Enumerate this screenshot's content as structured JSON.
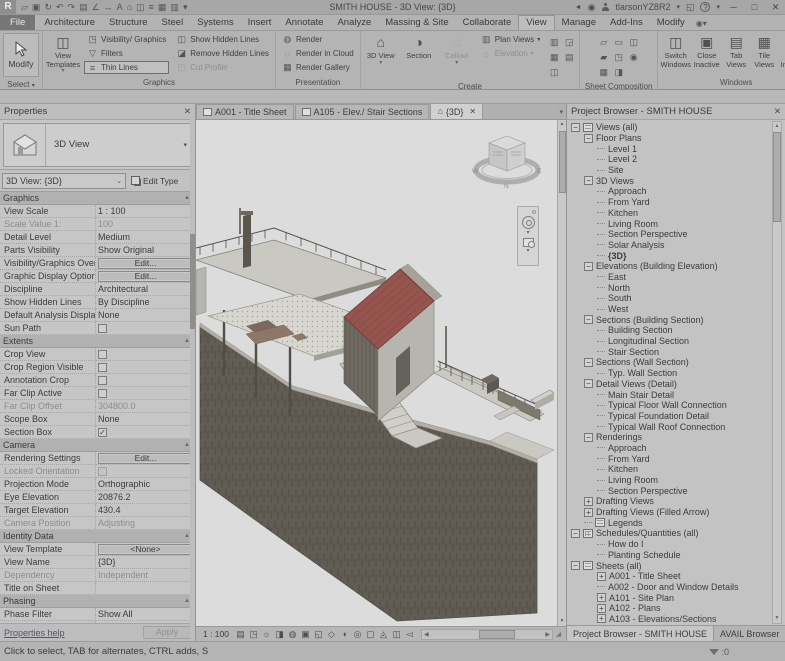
{
  "titlebar": {
    "app_initial": "R",
    "title": "SMITH HOUSE - 3D View: {3D}",
    "user": "tlarsonYZ8R2",
    "help": "?",
    "qat": [
      {
        "name": "open-file-icon",
        "glyph": "▱"
      },
      {
        "name": "save-icon",
        "glyph": "▣"
      },
      {
        "name": "synchronize-icon",
        "glyph": "↻"
      },
      {
        "name": "undo-icon",
        "glyph": "↶"
      },
      {
        "name": "redo-icon",
        "glyph": "↷"
      },
      {
        "name": "print-icon",
        "glyph": "▤"
      },
      {
        "name": "measure-icon",
        "glyph": "∠"
      },
      {
        "name": "aligned-dimension-icon",
        "glyph": "↔"
      },
      {
        "name": "text-note-icon",
        "glyph": "A"
      },
      {
        "name": "default-3d-view-icon",
        "glyph": "⌂"
      },
      {
        "name": "section-icon",
        "glyph": "◫"
      },
      {
        "name": "thin-lines-icon",
        "glyph": "≡"
      },
      {
        "name": "close-hidden-windows-icon",
        "glyph": "▦"
      },
      {
        "name": "switch-windows-icon",
        "glyph": "▥"
      },
      {
        "name": "customize-qat-icon",
        "glyph": "▾"
      }
    ]
  },
  "menu": {
    "tabs": [
      {
        "label": "File",
        "file": true
      },
      {
        "label": "Architecture"
      },
      {
        "label": "Structure"
      },
      {
        "label": "Steel"
      },
      {
        "label": "Systems"
      },
      {
        "label": "Insert"
      },
      {
        "label": "Annotate"
      },
      {
        "label": "Analyze"
      },
      {
        "label": "Massing & Site"
      },
      {
        "label": "Collaborate"
      },
      {
        "label": "View",
        "active": true
      },
      {
        "label": "Manage"
      },
      {
        "label": "Add-Ins"
      },
      {
        "label": "Modify"
      }
    ]
  },
  "ribbon": {
    "select": {
      "button": "Modify",
      "panel": "Select"
    },
    "graphics": {
      "big": "View Templates",
      "col1": [
        "Visibility/ Graphics",
        "Filters",
        "Thin Lines"
      ],
      "col2": [
        "Show Hidden Lines",
        "Remove Hidden Lines",
        "Cut Profile"
      ],
      "panel": "Graphics"
    },
    "presentation": {
      "items": [
        "Render",
        "Render in Cloud",
        "Render Gallery"
      ],
      "panel": "Presentation"
    },
    "create": {
      "bigs": [
        "3D View",
        "Section",
        "Callout"
      ],
      "col": [
        "Plan Views",
        "Elevation"
      ],
      "extra": [
        {
          "glyph": "▥"
        },
        {
          "glyph": "◲"
        },
        {
          "glyph": "▦"
        },
        {
          "glyph": "▤"
        },
        {
          "glyph": "◫"
        }
      ],
      "panel": "Create"
    },
    "sheet": {
      "icons": [
        "▱",
        "▭",
        "◫",
        "▰",
        "◳",
        "◉",
        "▦",
        "◨"
      ],
      "panel": "Sheet Composition"
    },
    "windows": {
      "bigs": [
        "Switch Windows",
        "Close Inactive",
        "Tab Views",
        "Tile Views",
        "User Interface"
      ],
      "panel": "Windows"
    }
  },
  "view_tabs": {
    "tabs": [
      {
        "label": "A001 - Title Sheet"
      },
      {
        "label": "A105 - Elev./ Stair Sections"
      },
      {
        "label": "{3D}"
      }
    ]
  },
  "properties": {
    "title": "Properties",
    "type_name": "3D View",
    "instance_selector": "3D View: {3D}",
    "edit_type": "Edit Type",
    "sections": [
      {
        "h": "Graphics",
        "rows": [
          [
            "View Scale",
            "1 : 100",
            "text"
          ],
          [
            "Scale Value    1:",
            "100",
            "gray"
          ],
          [
            "Detail Level",
            "Medium",
            "text"
          ],
          [
            "Parts Visibility",
            "Show Original",
            "text"
          ],
          [
            "Visibility/Graphics Overri...",
            "Edit...",
            "button"
          ],
          [
            "Graphic Display Options",
            "Edit...",
            "button"
          ],
          [
            "Discipline",
            "Architectural",
            "text"
          ],
          [
            "Show Hidden Lines",
            "By Discipline",
            "text"
          ],
          [
            "Default Analysis Display S...",
            "None",
            "text"
          ],
          [
            "Sun Path",
            "",
            "cb0"
          ]
        ]
      },
      {
        "h": "Extents",
        "rows": [
          [
            "Crop View",
            "",
            "cb0"
          ],
          [
            "Crop Region Visible",
            "",
            "cb0"
          ],
          [
            "Annotation Crop",
            "",
            "cb0"
          ],
          [
            "Far Clip Active",
            "",
            "cb0"
          ],
          [
            "Far Clip Offset",
            "304800.0",
            "gray"
          ],
          [
            "Scope Box",
            "None",
            "text"
          ],
          [
            "Section Box",
            "",
            "cb1"
          ]
        ]
      },
      {
        "h": "Camera",
        "rows": [
          [
            "Rendering Settings",
            "Edit...",
            "button"
          ],
          [
            "Locked Orientation",
            "",
            "cbd"
          ],
          [
            "Projection Mode",
            "Orthographic",
            "text"
          ],
          [
            "Eye Elevation",
            "20876.2",
            "text"
          ],
          [
            "Target Elevation",
            "430.4",
            "text"
          ],
          [
            "Camera Position",
            "Adjusting",
            "gray"
          ]
        ]
      },
      {
        "h": "Identity Data",
        "rows": [
          [
            "View Template",
            "<None>",
            "button"
          ],
          [
            "View Name",
            "{3D}",
            "text"
          ],
          [
            "Dependency",
            "Independent",
            "gray"
          ],
          [
            "Title on Sheet",
            "",
            "text"
          ]
        ]
      },
      {
        "h": "Phasing",
        "rows": [
          [
            "Phase Filter",
            "Show All",
            "text"
          ],
          [
            "Phase",
            "Working Drawings",
            "text"
          ]
        ]
      }
    ],
    "footer": {
      "help": "Properties help",
      "apply": "Apply"
    }
  },
  "project_browser": {
    "title": "Project Browser - SMITH HOUSE",
    "tree": [
      [
        0,
        "-",
        "views",
        "Views (all)",
        0
      ],
      [
        1,
        "-",
        "",
        "Floor Plans",
        0
      ],
      [
        2,
        "",
        "",
        "Level 1",
        0
      ],
      [
        2,
        "",
        "",
        "Level 2",
        0
      ],
      [
        2,
        "",
        "",
        "Site",
        0
      ],
      [
        1,
        "-",
        "",
        "3D Views",
        0
      ],
      [
        2,
        "",
        "",
        "Approach",
        0
      ],
      [
        2,
        "",
        "",
        "From Yard",
        0
      ],
      [
        2,
        "",
        "",
        "Kitchen",
        0
      ],
      [
        2,
        "",
        "",
        "Living Room",
        0
      ],
      [
        2,
        "",
        "",
        "Section Perspective",
        0
      ],
      [
        2,
        "",
        "",
        "Solar Analysis",
        0
      ],
      [
        2,
        "",
        "",
        "{3D}",
        1
      ],
      [
        1,
        "-",
        "",
        "Elevations (Building Elevation)",
        0
      ],
      [
        2,
        "",
        "",
        "East",
        0
      ],
      [
        2,
        "",
        "",
        "North",
        0
      ],
      [
        2,
        "",
        "",
        "South",
        0
      ],
      [
        2,
        "",
        "",
        "West",
        0
      ],
      [
        1,
        "-",
        "",
        "Sections (Building Section)",
        0
      ],
      [
        2,
        "",
        "",
        "Building Section",
        0
      ],
      [
        2,
        "",
        "",
        "Longitudinal Section",
        0
      ],
      [
        2,
        "",
        "",
        "Stair Section",
        0
      ],
      [
        1,
        "-",
        "",
        "Sections (Wall Section)",
        0
      ],
      [
        2,
        "",
        "",
        "Typ. Wall Section",
        0
      ],
      [
        1,
        "-",
        "",
        "Detail Views (Detail)",
        0
      ],
      [
        2,
        "",
        "",
        "Main Stair Detail",
        0
      ],
      [
        2,
        "",
        "",
        "Typical Floor Wall Connection",
        0
      ],
      [
        2,
        "",
        "",
        "Typical Foundation Detail",
        0
      ],
      [
        2,
        "",
        "",
        "Typical Wall Roof Connection",
        0
      ],
      [
        1,
        "-",
        "",
        "Renderings",
        0
      ],
      [
        2,
        "",
        "",
        "Approach",
        0
      ],
      [
        2,
        "",
        "",
        "From Yard",
        0
      ],
      [
        2,
        "",
        "",
        "Kitchen",
        0
      ],
      [
        2,
        "",
        "",
        "Living Room",
        0
      ],
      [
        2,
        "",
        "",
        "Section Perspective",
        0
      ],
      [
        1,
        "+",
        "",
        "Drafting Views",
        0
      ],
      [
        1,
        "+",
        "",
        "Drafting Views (Filled Arrow)",
        0
      ],
      [
        1,
        "",
        "views",
        "Legends",
        0
      ],
      [
        0,
        "-",
        "sched",
        "Schedules/Quantities (all)",
        0
      ],
      [
        2,
        "",
        "",
        "How do I",
        0
      ],
      [
        2,
        "",
        "",
        "Planting Schedule",
        0
      ],
      [
        0,
        "-",
        "views",
        "Sheets (all)",
        0
      ],
      [
        2,
        "+",
        "",
        "A001 - Title Sheet",
        0
      ],
      [
        2,
        "",
        "",
        "A002 - Door and Window Details",
        0
      ],
      [
        2,
        "+",
        "",
        "A101 - Site Plan",
        0
      ],
      [
        2,
        "+",
        "",
        "A102 - Plans",
        0
      ],
      [
        2,
        "+",
        "",
        "A103 - Elevations/Sections",
        0
      ]
    ],
    "tabs": [
      "Project Browser - SMITH HOUSE",
      "AVAIL Browser"
    ]
  },
  "view_control_bar": {
    "scale": "1 : 100",
    "icons": [
      {
        "name": "detail-level-icon",
        "glyph": "▤"
      },
      {
        "name": "visual-style-icon",
        "glyph": "◳"
      },
      {
        "name": "sun-path-icon",
        "glyph": "☼"
      },
      {
        "name": "shadows-icon",
        "glyph": "◨"
      },
      {
        "name": "rendering-dialog-icon",
        "glyph": "◍"
      },
      {
        "name": "crop-view-icon",
        "glyph": "▣"
      },
      {
        "name": "show-crop-region-icon",
        "glyph": "◱"
      },
      {
        "name": "unlocked-view-icon",
        "glyph": "◇"
      },
      {
        "name": "temporary-hide-isolate-icon",
        "glyph": "◖"
      },
      {
        "name": "reveal-hidden-elements-icon",
        "glyph": "◎"
      },
      {
        "name": "temporary-view-properties-icon",
        "glyph": "▢"
      },
      {
        "name": "show-analytical-model-icon",
        "glyph": "◬"
      },
      {
        "name": "highlight-displacement-icon",
        "glyph": "◫"
      },
      {
        "name": "more-tools-icon",
        "glyph": "◅"
      }
    ]
  },
  "viewcube": {
    "compass": {
      "w": "W",
      "n": "N",
      "e": "E"
    }
  },
  "status_bar": {
    "message": "Click to select, TAB for alternates, CTRL adds, S",
    "filter_count": ":0"
  }
}
